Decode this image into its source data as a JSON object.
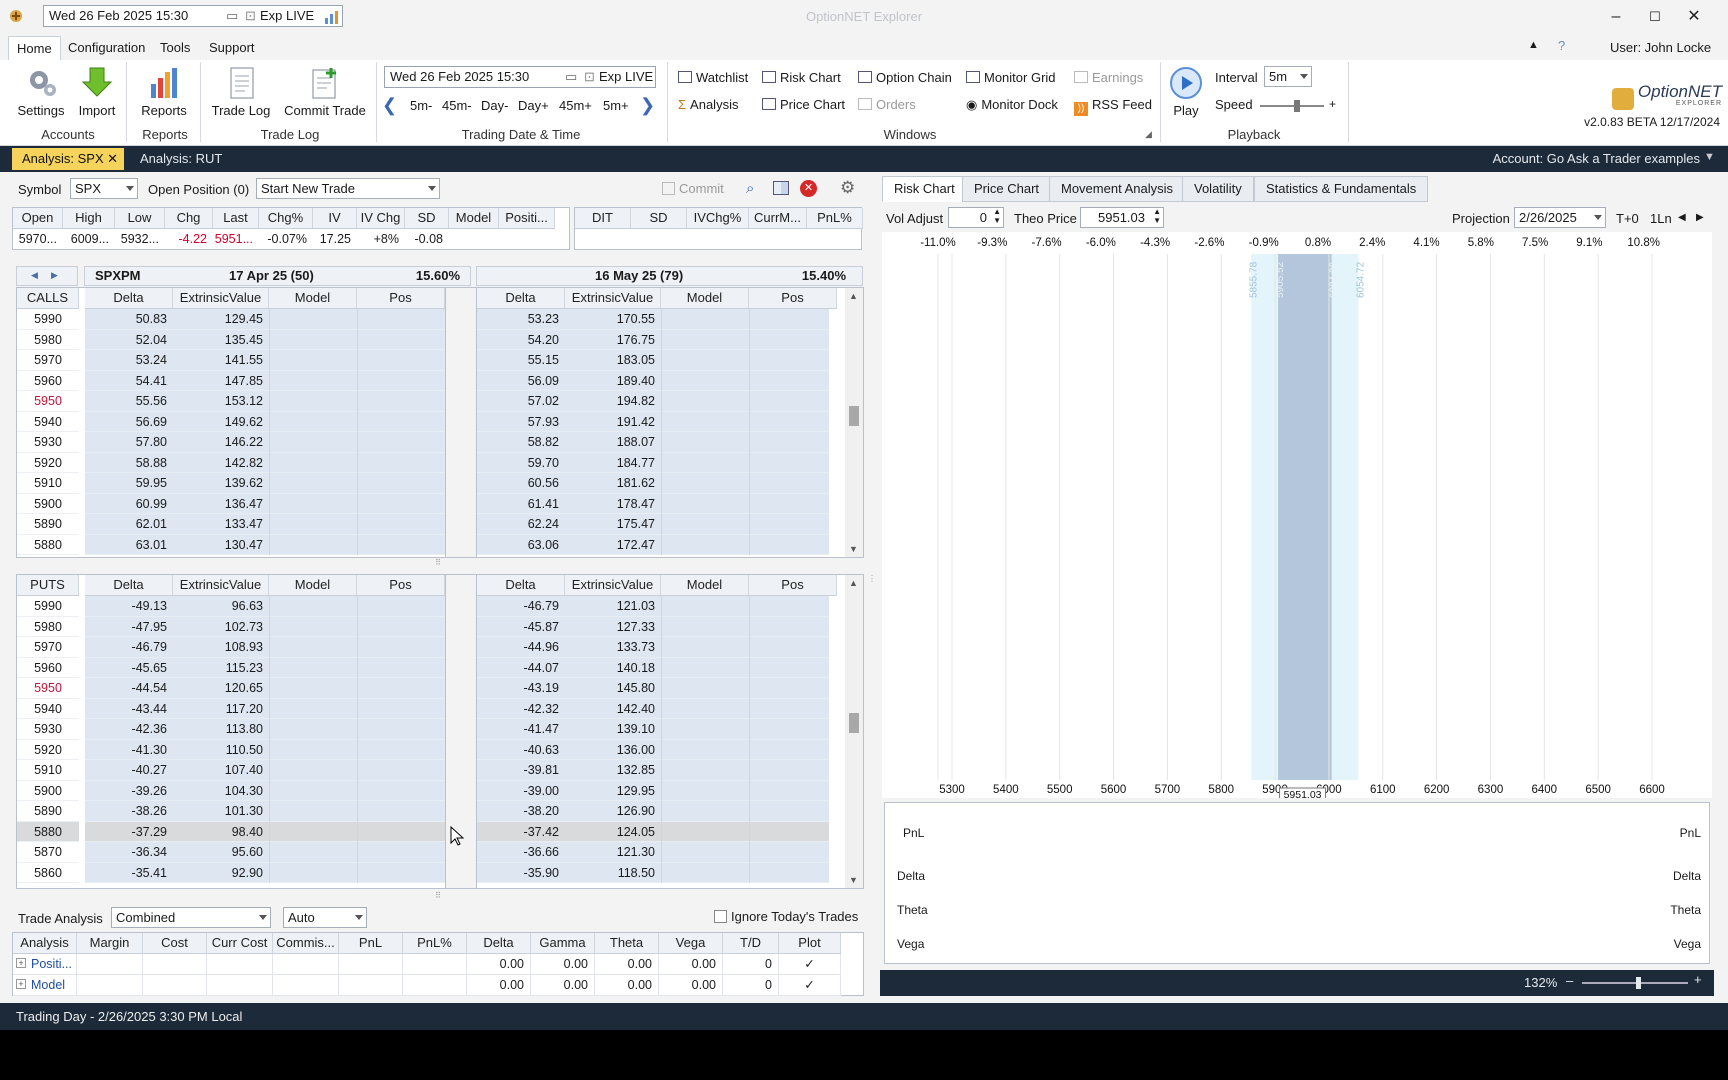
{
  "titlebar": {
    "datetime": "Wed 26 Feb 2025 15:30",
    "exp": "Exp LIVE",
    "app_title": "OptionNET Explorer"
  },
  "menu": {
    "items": [
      "Home",
      "Configuration",
      "Tools",
      "Support"
    ],
    "user": "User: John Locke"
  },
  "ribbon": {
    "settings": "Settings",
    "import": "Import",
    "reports": "Reports",
    "trade_log": "Trade Log",
    "commit_trade": "Commit Trade",
    "groups": [
      "Accounts",
      "Reports",
      "Trade Log",
      "Trading Date & Time",
      "Windows",
      "Playback"
    ],
    "trading_datetime": "Wed 26 Feb 2025 15:30",
    "exp": "Exp LIVE",
    "steps": [
      "5m-",
      "45m-",
      "Day-",
      "Day+",
      "45m+",
      "5m+"
    ],
    "windows_row1": [
      "Watchlist",
      "Risk Chart",
      "Option Chain",
      "Monitor Grid",
      "Earnings"
    ],
    "windows_row2": [
      "Analysis",
      "Price Chart",
      "Orders",
      "Monitor Dock",
      "RSS Feed"
    ],
    "play": "Play",
    "interval_label": "Interval",
    "interval_value": "5m",
    "speed_label": "Speed",
    "logo": "OptionNET",
    "logo_sub": "EXPLORER",
    "version": "v2.0.83 BETA 12/17/2024"
  },
  "doc_tabs": {
    "tab1": "Analysis: SPX",
    "tab2": "Analysis: RUT",
    "account": "Account: Go Ask a Trader examples"
  },
  "toolbar": {
    "symbol_label": "Symbol",
    "symbol": "SPX",
    "open_position": "Open Position (0)",
    "trade_select": "Start New Trade",
    "commit": "Commit"
  },
  "quote": {
    "headers": [
      "Open",
      "High",
      "Low",
      "Chg",
      "Last",
      "Chg%",
      "IV",
      "IV Chg",
      "SD",
      "Model",
      "Positi..."
    ],
    "values": [
      "5970...",
      "6009...",
      "5932...",
      "-4.22",
      "5951...",
      "-0.07%",
      "17.25",
      "+8%",
      "-0.08",
      "",
      ""
    ],
    "headers2": [
      "DIT",
      "SD",
      "IVChg%",
      "CurrM...",
      "PnL%"
    ]
  },
  "chain": {
    "root": "SPXPM",
    "exp1": "17 Apr 25 (50)",
    "exp1_iv": "15.60%",
    "exp2": "16 May 25 (79)",
    "exp2_iv": "15.40%",
    "calls_label": "CALLS",
    "puts_label": "PUTS",
    "col_headers": [
      "Delta",
      "ExtrinsicValue",
      "Model",
      "Pos"
    ],
    "calls": [
      [
        "5990",
        "50.83",
        "129.45",
        "53.23",
        "170.55"
      ],
      [
        "5980",
        "52.04",
        "135.45",
        "54.20",
        "176.75"
      ],
      [
        "5970",
        "53.24",
        "141.55",
        "55.15",
        "183.05"
      ],
      [
        "5960",
        "54.41",
        "147.85",
        "56.09",
        "189.40"
      ],
      [
        "5950",
        "55.56",
        "153.12",
        "57.02",
        "194.82"
      ],
      [
        "5940",
        "56.69",
        "149.62",
        "57.93",
        "191.42"
      ],
      [
        "5930",
        "57.80",
        "146.22",
        "58.82",
        "188.07"
      ],
      [
        "5920",
        "58.88",
        "142.82",
        "59.70",
        "184.77"
      ],
      [
        "5910",
        "59.95",
        "139.62",
        "60.56",
        "181.62"
      ],
      [
        "5900",
        "60.99",
        "136.47",
        "61.41",
        "178.47"
      ],
      [
        "5890",
        "62.01",
        "133.47",
        "62.24",
        "175.47"
      ],
      [
        "5880",
        "63.01",
        "130.47",
        "63.06",
        "172.47"
      ]
    ],
    "puts": [
      [
        "5990",
        "-49.13",
        "96.63",
        "-46.79",
        "121.03"
      ],
      [
        "5980",
        "-47.95",
        "102.73",
        "-45.87",
        "127.33"
      ],
      [
        "5970",
        "-46.79",
        "108.93",
        "-44.96",
        "133.73"
      ],
      [
        "5960",
        "-45.65",
        "115.23",
        "-44.07",
        "140.18"
      ],
      [
        "5950",
        "-44.54",
        "120.65",
        "-43.19",
        "145.80"
      ],
      [
        "5940",
        "-43.44",
        "117.20",
        "-42.32",
        "142.40"
      ],
      [
        "5930",
        "-42.36",
        "113.80",
        "-41.47",
        "139.10"
      ],
      [
        "5920",
        "-41.30",
        "110.50",
        "-40.63",
        "136.00"
      ],
      [
        "5910",
        "-40.27",
        "107.40",
        "-39.81",
        "132.85"
      ],
      [
        "5900",
        "-39.26",
        "104.30",
        "-39.00",
        "129.95"
      ],
      [
        "5890",
        "-38.26",
        "101.30",
        "-38.20",
        "126.90"
      ],
      [
        "5880",
        "-37.29",
        "98.40",
        "-37.42",
        "124.05"
      ],
      [
        "5870",
        "-36.34",
        "95.60",
        "-36.66",
        "121.30"
      ],
      [
        "5860",
        "-35.41",
        "92.90",
        "-35.90",
        "118.50"
      ]
    ]
  },
  "trade_analysis": {
    "label": "Trade Analysis",
    "mode": "Combined",
    "auto": "Auto",
    "ignore": "Ignore Today's Trades",
    "headers": [
      "Analysis",
      "Margin",
      "Cost",
      "Curr Cost",
      "Commis...",
      "PnL",
      "PnL%",
      "Delta",
      "Gamma",
      "Theta",
      "Vega",
      "T/D",
      "Plot"
    ],
    "rows": [
      [
        "Positi...",
        "",
        "",
        "",
        "",
        "",
        "",
        "0.00",
        "0.00",
        "0.00",
        "0.00",
        "0",
        "✓"
      ],
      [
        "Model",
        "",
        "",
        "",
        "",
        "",
        "",
        "0.00",
        "0.00",
        "0.00",
        "0.00",
        "0",
        "✓"
      ]
    ]
  },
  "right_tabs": [
    "Risk Chart",
    "Price Chart",
    "Movement Analysis",
    "Volatility",
    "Statistics & Fundamentals"
  ],
  "right_toolbar": {
    "vol_adjust_label": "Vol Adjust",
    "vol_adjust": "0",
    "theo_label": "Theo Price",
    "theo": "5951.03",
    "projection_label": "Projection",
    "projection": "2/26/2025",
    "t0": "T+0",
    "lines": "1Ln"
  },
  "risk_chart": {
    "pct_labels": [
      "-11.0%",
      "-9.3%",
      "-7.6%",
      "-6.0%",
      "-4.3%",
      "-2.6%",
      "-0.9%",
      "0.8%",
      "2.4%",
      "4.1%",
      "5.8%",
      "7.5%",
      "9.1%",
      "10.8%"
    ],
    "x_labels": [
      "5300",
      "5400",
      "5500",
      "5600",
      "5700",
      "5800",
      "5900",
      "6000",
      "6100",
      "6200",
      "6300",
      "6400",
      "6500",
      "6600"
    ],
    "band_labels": [
      "5855.78",
      "5905.52",
      "6004.99",
      "6054.72"
    ],
    "marker": "5951.03",
    "lower_labels": [
      "PnL",
      "Delta",
      "Theta",
      "Vega"
    ],
    "zoom": "132%"
  },
  "status": {
    "text": "Trading Day - 2/26/2025 3:30 PM Local"
  },
  "colors": {
    "accent_tab": "#f6d35a",
    "dark_bar": "#1c2a3a",
    "grid_blue": "#dde6f1",
    "atm_red": "#c0143c",
    "neg_red": "#d4002a"
  }
}
